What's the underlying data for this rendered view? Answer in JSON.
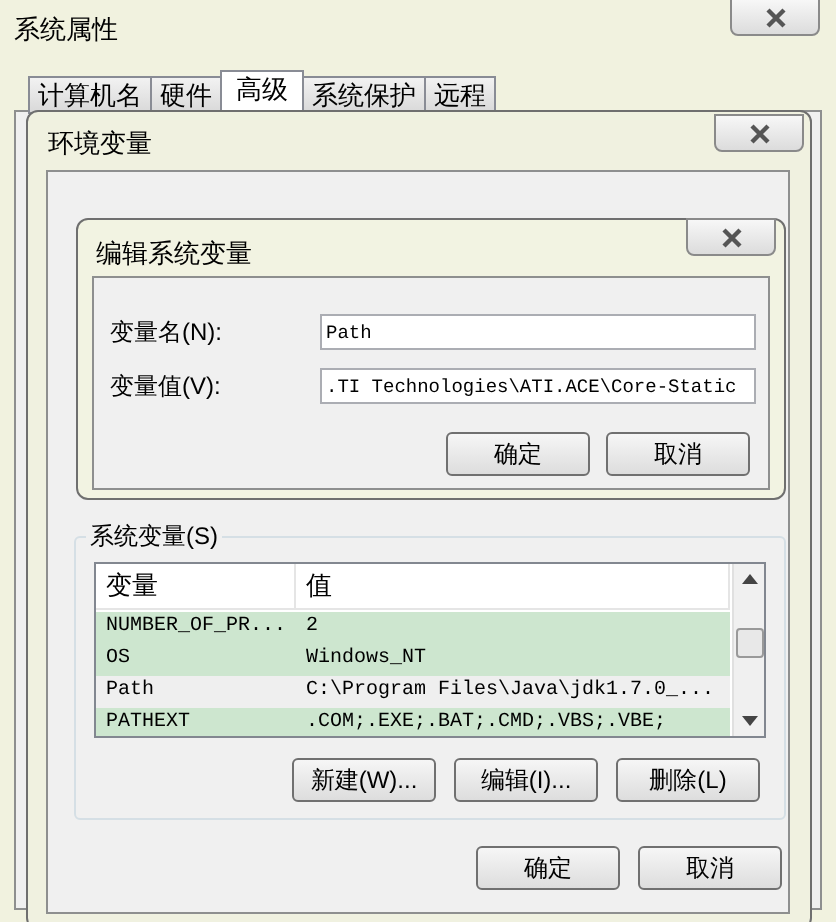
{
  "system_properties": {
    "title": "系统属性",
    "tabs": [
      {
        "label": "计算机名",
        "selected": false
      },
      {
        "label": "硬件",
        "selected": false
      },
      {
        "label": "高级",
        "selected": true
      },
      {
        "label": "系统保护",
        "selected": false
      },
      {
        "label": "远程",
        "selected": false
      }
    ]
  },
  "environment_variables": {
    "title": "环境变量",
    "system_group": {
      "label": "系统变量(S)",
      "columns": [
        "变量",
        "值"
      ],
      "rows": [
        {
          "name": "NUMBER_OF_PR...",
          "value": "2",
          "selected": false
        },
        {
          "name": "OS",
          "value": "Windows_NT",
          "selected": false
        },
        {
          "name": "Path",
          "value": "C:\\Program Files\\Java\\jdk1.7.0_...",
          "selected": true
        },
        {
          "name": "PATHEXT",
          "value": ".COM;.EXE;.BAT;.CMD;.VBS;.VBE;",
          "selected": false
        }
      ],
      "buttons": [
        "新建(W)...",
        "编辑(I)...",
        "删除(L)"
      ]
    },
    "buttons": [
      "确定",
      "取消"
    ]
  },
  "edit_dialog": {
    "title": "编辑系统变量",
    "fields": [
      {
        "label": "变量名(N):",
        "value": "Path"
      },
      {
        "label": "变量值(V):",
        "value": ".TI Technologies\\ATI.ACE\\Core-Static"
      }
    ],
    "buttons": [
      "确定",
      "取消"
    ]
  }
}
